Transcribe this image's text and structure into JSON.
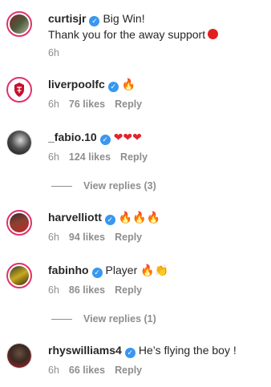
{
  "comments": [
    {
      "username": "curtisjr",
      "verified": true,
      "text": "Big Win!",
      "text2": "Thank you for the away support",
      "time": "6h",
      "likes": "",
      "reply": ""
    },
    {
      "username": "liverpoolfc",
      "verified": true,
      "text": "🔥",
      "time": "6h",
      "likes": "76 likes",
      "reply": "Reply"
    },
    {
      "username": "_fabio.10",
      "verified": true,
      "text": "❤❤❤",
      "time": "6h",
      "likes": "124 likes",
      "reply": "Reply",
      "view_replies": "View replies (3)"
    },
    {
      "username": "harvelliott",
      "verified": true,
      "text": "🔥🔥🔥",
      "time": "6h",
      "likes": "94 likes",
      "reply": "Reply"
    },
    {
      "username": "fabinho",
      "verified": true,
      "text": "Player",
      "emoji": "🔥👏",
      "time": "6h",
      "likes": "86 likes",
      "reply": "Reply",
      "view_replies": "View replies (1)"
    },
    {
      "username": "rhyswilliams4",
      "verified": true,
      "text": "He’s flying the boy !",
      "time": "6h",
      "likes": "66 likes",
      "reply": "Reply"
    }
  ],
  "colors": {
    "ring": "#e1306c",
    "verified": "#3897f0",
    "meta_text": "#8e8e8e",
    "text": "#262626"
  },
  "icons": {
    "verified": "verified-badge-icon",
    "red_circle": "red-circle-emoji"
  }
}
